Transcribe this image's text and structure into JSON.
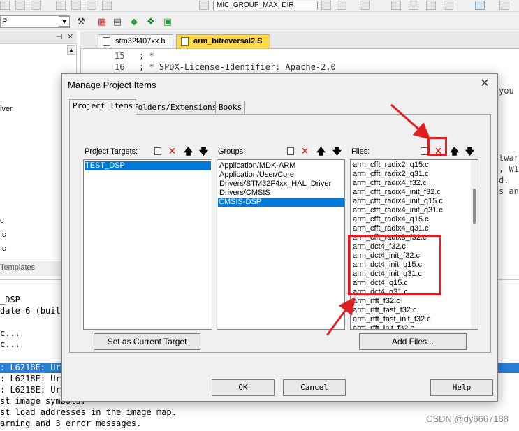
{
  "toolbar": {
    "target_combo": "MIC_GROUP_MAX_DIR",
    "target_select_fragment": "P"
  },
  "left_panel": {
    "lines": [
      "iver",
      "c",
      ".c",
      ".c"
    ],
    "bottom_tab": "Templates"
  },
  "editor": {
    "tabs": [
      {
        "label": "stm32f407xx.h"
      },
      {
        "label": "arm_bitreversal2.S"
      }
    ],
    "code_lines": [
      {
        "num": "15",
        "text": "; *"
      },
      {
        "num": "16",
        "text": "; * SPDX-License-Identifier: Apache-2.0"
      }
    ],
    "right_fragments": [
      "you",
      "twar",
      ", WI",
      "d.",
      "s an"
    ]
  },
  "build_output": {
    "lines": [
      "_DSP",
      "date 6 (buil",
      "",
      "c...",
      "c...",
      "",
      ": L6218E: Ur",
      ": L6218E: Ur",
      ": L6218E: Ur",
      "st image symbols.",
      "st load addresses in the image map.",
      "arning and 3 error messages."
    ]
  },
  "watermark": "CSDN @dy6667188",
  "dialog": {
    "title": "Manage Project Items",
    "close_icon": "✕",
    "tabs": [
      "Project Items",
      "Folders/Extensions",
      "Books"
    ],
    "targets": {
      "label": "Project Targets:",
      "items": [
        "TEST_DSP"
      ],
      "selected": 0
    },
    "groups": {
      "label": "Groups:",
      "items": [
        "Application/MDK-ARM",
        "Application/User/Core",
        "Drivers/STM32F4xx_HAL_Driver",
        "Drivers/CMSIS",
        "CMSIS-DSP"
      ],
      "selected": 4
    },
    "files": {
      "label": "Files:",
      "items": [
        "arm_cfft_radix2_q15.c",
        "arm_cfft_radix2_q31.c",
        "arm_cfft_radix4_f32.c",
        "arm_cfft_radix4_init_f32.c",
        "arm_cfft_radix4_init_q15.c",
        "arm_cfft_radix4_init_q31.c",
        "arm_cfft_radix4_q15.c",
        "arm_cfft_radix4_q31.c",
        "arm_cfft_radix8_f32.c",
        "arm_dct4_f32.c",
        "arm_dct4_init_f32.c",
        "arm_dct4_init_q15.c",
        "arm_dct4_init_q31.c",
        "arm_dct4_q15.c",
        "arm_dct4_q31.c",
        "arm_rfft_f32.c",
        "arm_rfft_fast_f32.c",
        "arm_rfft_fast_init_f32.c",
        "arm_rfft_init_f32.c"
      ]
    },
    "buttons": {
      "set_current_target": "Set as Current Target",
      "add_files": "Add Files...",
      "ok": "OK",
      "cancel": "Cancel",
      "help": "Help"
    },
    "icon_names": [
      "new-item-icon",
      "delete-icon",
      "move-up-icon",
      "move-down-icon"
    ],
    "annotation_color": "#e02020",
    "selection_color": "#0078d7"
  }
}
